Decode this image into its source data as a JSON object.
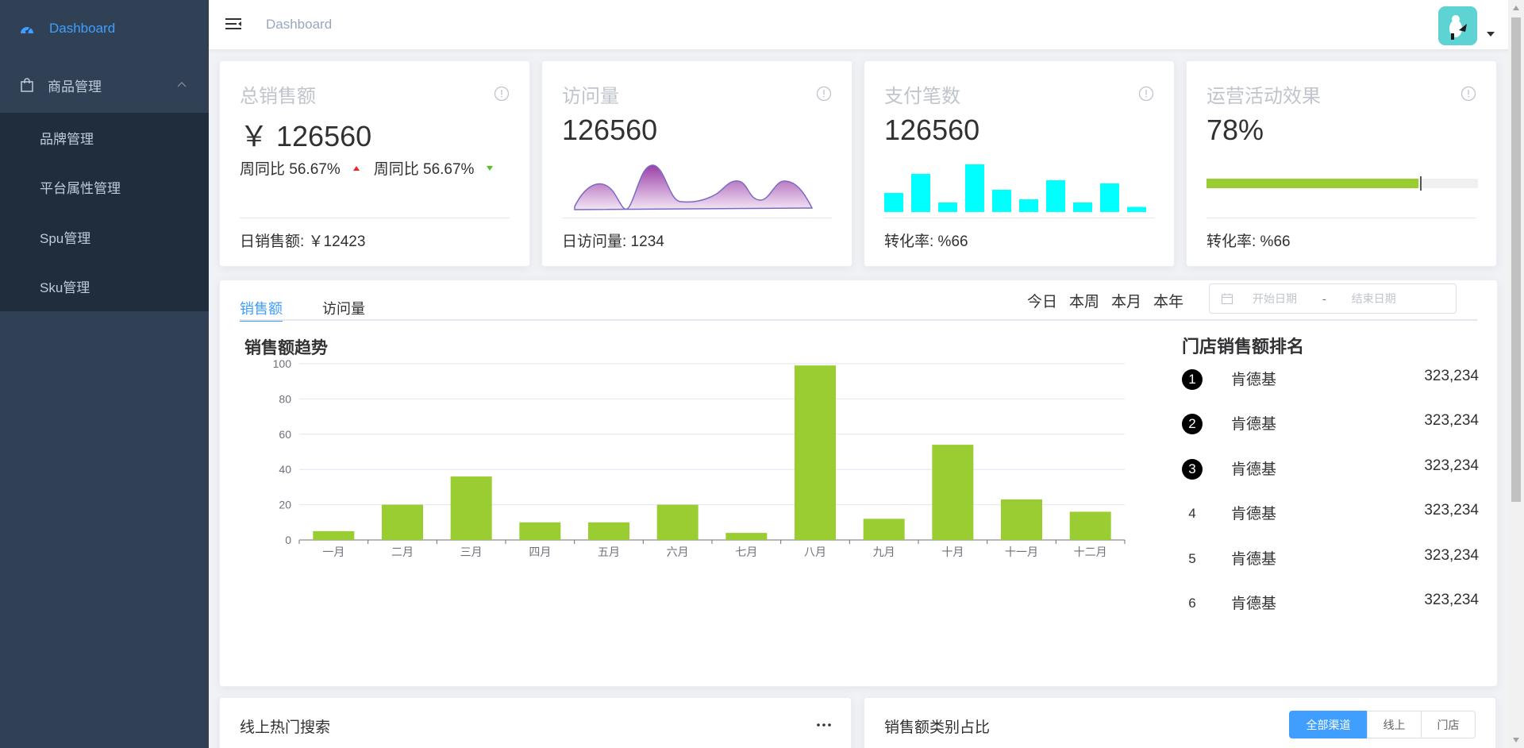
{
  "sidebar": {
    "dashboard_label": "Dashboard",
    "group_label": "商品管理",
    "items": [
      {
        "label": "品牌管理"
      },
      {
        "label": "平台属性管理"
      },
      {
        "label": "Spu管理"
      },
      {
        "label": "Sku管理"
      }
    ]
  },
  "header": {
    "breadcrumb": "Dashboard"
  },
  "stats": [
    {
      "title": "总销售额",
      "value": "￥ 126560",
      "compare_1": "周同比 56.67%",
      "compare_2": "周同比 56.67%",
      "footer": "日销售额: ￥12423"
    },
    {
      "title": "访问量",
      "value": "126560",
      "footer": "日访问量: 1234"
    },
    {
      "title": "支付笔数",
      "value": "126560",
      "footer": "转化率: %66",
      "bar_values": [
        3,
        6,
        1.5,
        7.5,
        3.5,
        2,
        5,
        1.5,
        4.5,
        0.8
      ]
    },
    {
      "title": "运营活动效果",
      "value": "78%",
      "footer": "转化率: %66",
      "progress": 0.78
    }
  ],
  "colors": {
    "accent": "#409eff",
    "bar_green": "#9acd32",
    "cyan": "#00ffff",
    "sidebar_bg": "#304156",
    "submenu_bg": "#1f2d3d"
  },
  "tabs": [
    {
      "label": "销售额"
    },
    {
      "label": "访问量"
    }
  ],
  "ranges": [
    "今日",
    "本周",
    "本月",
    "本年"
  ],
  "date_range": {
    "start": "开始日期",
    "sep": "-",
    "end": "结束日期"
  },
  "chart_title": "销售额趋势",
  "chart_data": {
    "type": "bar",
    "categories": [
      "一月",
      "二月",
      "三月",
      "四月",
      "五月",
      "六月",
      "七月",
      "八月",
      "九月",
      "十月",
      "十一月",
      "十二月"
    ],
    "values": [
      5,
      20,
      36,
      10,
      10,
      20,
      4,
      99,
      12,
      54,
      23,
      16
    ],
    "ylim": [
      0,
      100
    ],
    "yticks": [
      0,
      20,
      40,
      60,
      80,
      100
    ],
    "grid": true,
    "color": "#9acd32"
  },
  "rank": {
    "title": "门店销售额排名",
    "rows": [
      {
        "no": "1",
        "name": "肯德基",
        "value": "323,234"
      },
      {
        "no": "2",
        "name": "肯德基",
        "value": "323,234"
      },
      {
        "no": "3",
        "name": "肯德基",
        "value": "323,234"
      },
      {
        "no": "4",
        "name": "肯德基",
        "value": "323,234"
      },
      {
        "no": "5",
        "name": "肯德基",
        "value": "323,234"
      },
      {
        "no": "6",
        "name": "肯德基",
        "value": "323,234"
      }
    ]
  },
  "bottom": {
    "left_title": "线上热门搜索",
    "right_title": "销售额类别占比",
    "segments": [
      {
        "label": "全部渠道"
      },
      {
        "label": "线上"
      },
      {
        "label": "门店"
      }
    ]
  }
}
